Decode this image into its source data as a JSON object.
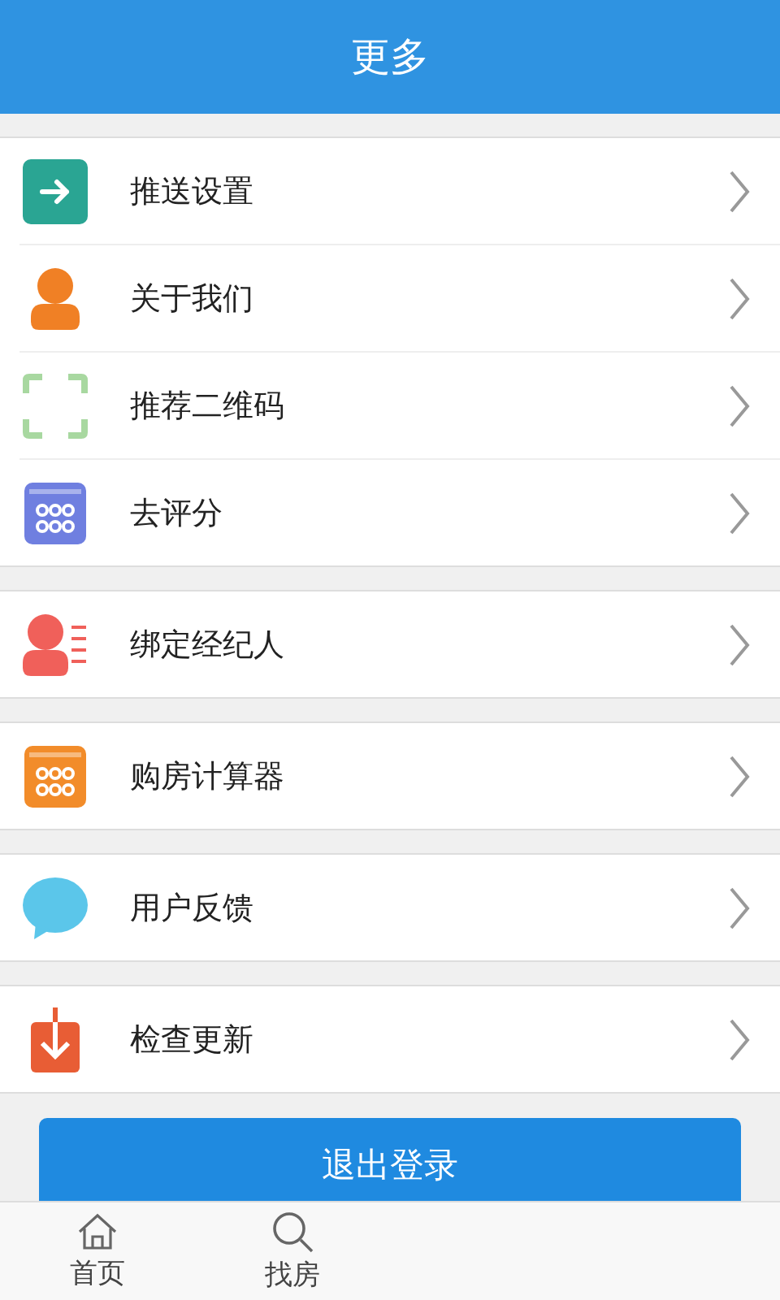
{
  "header": {
    "title": "更多"
  },
  "groups": [
    {
      "items": [
        {
          "label": "推送设置",
          "kind": "arrow"
        },
        {
          "label": "关于我们",
          "kind": "person"
        },
        {
          "label": "推荐二维码",
          "kind": "scan"
        },
        {
          "label": "去评分",
          "kind": "grid-blue"
        }
      ]
    },
    {
      "items": [
        {
          "label": "绑定经纪人",
          "kind": "agent"
        }
      ]
    },
    {
      "items": [
        {
          "label": "购房计算器",
          "kind": "grid-orange"
        }
      ]
    },
    {
      "items": [
        {
          "label": "用户反馈",
          "kind": "bubble"
        }
      ]
    },
    {
      "items": [
        {
          "label": "检查更新",
          "kind": "download"
        }
      ]
    }
  ],
  "logout_button": "退出登录",
  "tab_bar": [
    {
      "label": "首页",
      "kind": "home"
    },
    {
      "label": "找房",
      "kind": "search"
    }
  ]
}
